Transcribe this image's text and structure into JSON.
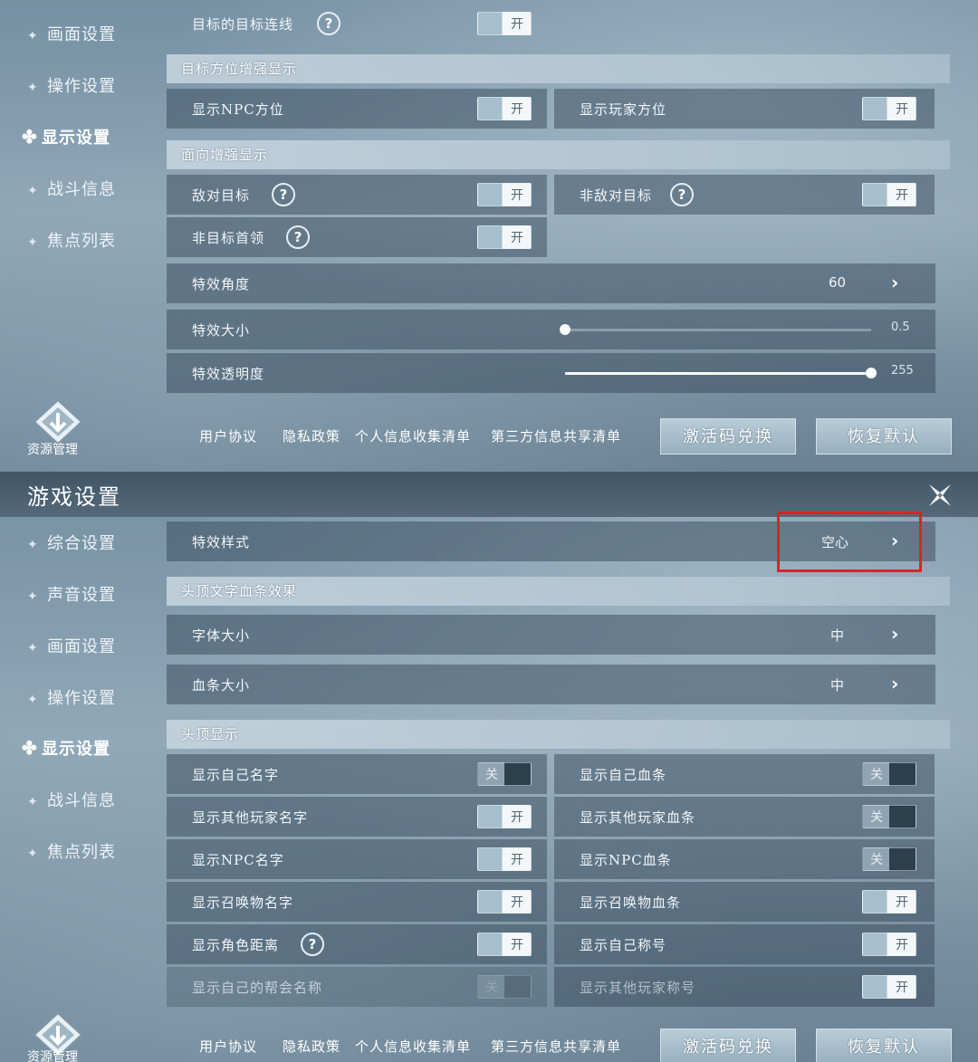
{
  "panel1": {
    "sidebar": [
      {
        "label": "画面设置"
      },
      {
        "label": "操作设置"
      },
      {
        "label": "显示设置",
        "active": true
      },
      {
        "label": "战斗信息"
      },
      {
        "label": "焦点列表"
      }
    ],
    "target_line": {
      "label": "目标的目标连线",
      "toggle": "开"
    },
    "section_target_direction": "目标方位增强显示",
    "show_npc_direction": {
      "label": "显示NPC方位",
      "toggle": "开"
    },
    "show_player_direction": {
      "label": "显示玩家方位",
      "toggle": "开"
    },
    "section_facing": "面向增强显示",
    "hostile_target": {
      "label": "敌对目标",
      "toggle": "开"
    },
    "non_hostile_target": {
      "label": "非敌对目标",
      "toggle": "开"
    },
    "non_target_leader": {
      "label": "非目标首领",
      "toggle": "开"
    },
    "effect_angle": {
      "label": "特效角度",
      "value": "60"
    },
    "effect_size": {
      "label": "特效大小",
      "value": "0.5",
      "fraction": 0.0
    },
    "effect_opacity": {
      "label": "特效透明度",
      "value": "255",
      "fraction": 1.0
    },
    "links": [
      "用户协议",
      "隐私政策",
      "个人信息收集清单",
      "第三方信息共享清单"
    ],
    "btn_redeem": "激活码兑换",
    "btn_reset": "恢复默认",
    "resource_label": "资源管理"
  },
  "panel2": {
    "title": "游戏设置",
    "sidebar": [
      {
        "label": "综合设置"
      },
      {
        "label": "声音设置"
      },
      {
        "label": "画面设置"
      },
      {
        "label": "操作设置"
      },
      {
        "label": "显示设置",
        "active": true
      },
      {
        "label": "战斗信息"
      },
      {
        "label": "焦点列表"
      }
    ],
    "effect_style": {
      "label": "特效样式",
      "value": "空心"
    },
    "section_overhead_text": "头顶文字血条效果",
    "font_size": {
      "label": "字体大小",
      "value": "中"
    },
    "bar_size": {
      "label": "血条大小",
      "value": "中"
    },
    "section_overhead": "头顶显示",
    "toggles_left": [
      {
        "label": "显示自己名字",
        "toggle": "关",
        "state": "off"
      },
      {
        "label": "显示其他玩家名字",
        "toggle": "开",
        "state": "on"
      },
      {
        "label": "显示NPC名字",
        "toggle": "开",
        "state": "on"
      },
      {
        "label": "显示召唤物名字",
        "toggle": "开",
        "state": "on"
      },
      {
        "label": "显示角色距离",
        "toggle": "开",
        "state": "on"
      },
      {
        "label": "显示自己的帮会名称",
        "toggle": "关",
        "state": "off"
      }
    ],
    "toggles_right": [
      {
        "label": "显示自己血条",
        "toggle": "关",
        "state": "off"
      },
      {
        "label": "显示其他玩家血条",
        "toggle": "关",
        "state": "off"
      },
      {
        "label": "显示NPC血条",
        "toggle": "关",
        "state": "off"
      },
      {
        "label": "显示召唤物血条",
        "toggle": "开",
        "state": "on"
      },
      {
        "label": "显示自己称号",
        "toggle": "开",
        "state": "on"
      },
      {
        "label": "显示其他玩家称号",
        "toggle": "开",
        "state": "on"
      }
    ],
    "links": [
      "用户协议",
      "隐私政策",
      "个人信息收集清单",
      "第三方信息共享清单"
    ],
    "btn_redeem": "激活码兑换",
    "btn_reset": "恢复默认",
    "resource_label": "资源管理"
  }
}
